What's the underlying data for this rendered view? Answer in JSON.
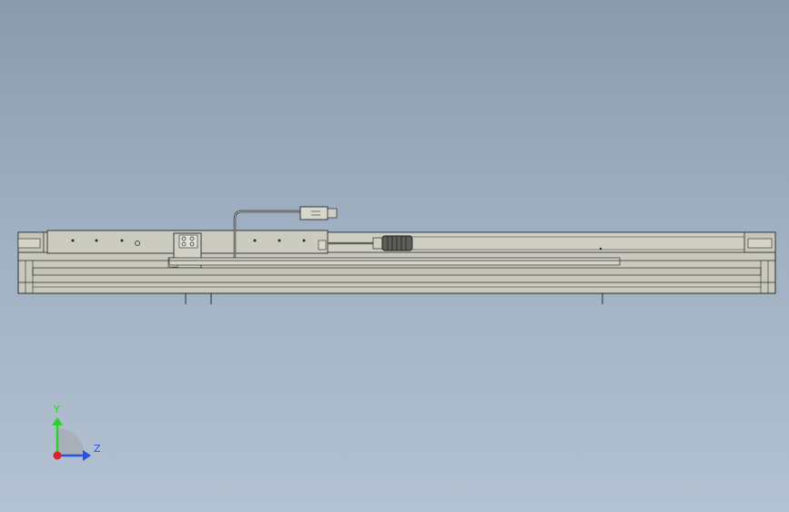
{
  "viewport": {
    "background_top": "#8a9bae",
    "background_bottom": "#b3c2d2"
  },
  "model": {
    "body_color": "#c9c8bd",
    "edge_color": "#2b2b2b",
    "rail_color": "#bdbdb3"
  },
  "triad": {
    "y_label": "Y",
    "z_label": "Z",
    "y_color": "#2bd12b",
    "z_color": "#2b4fe0",
    "x_color": "#e0202a"
  }
}
